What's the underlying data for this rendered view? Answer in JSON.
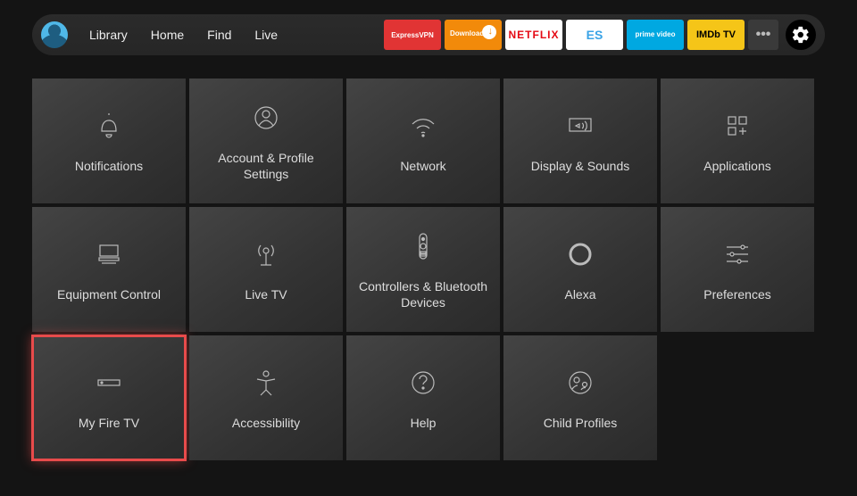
{
  "nav": {
    "library": "Library",
    "home": "Home",
    "find": "Find",
    "live": "Live"
  },
  "apps": {
    "express": "ExpressVPN",
    "downloader": "Downloader",
    "netflix": "NETFLIX",
    "es": "ES",
    "prime": "prime video",
    "imdb": "IMDb TV",
    "more": "•••"
  },
  "tiles": {
    "notifications": "Notifications",
    "account": "Account & Profile Settings",
    "network": "Network",
    "display": "Display & Sounds",
    "applications": "Applications",
    "equipment": "Equipment Control",
    "livetv": "Live TV",
    "controllers": "Controllers & Bluetooth Devices",
    "alexa": "Alexa",
    "preferences": "Preferences",
    "myfiretv": "My Fire TV",
    "accessibility": "Accessibility",
    "help": "Help",
    "childprofiles": "Child Profiles"
  }
}
